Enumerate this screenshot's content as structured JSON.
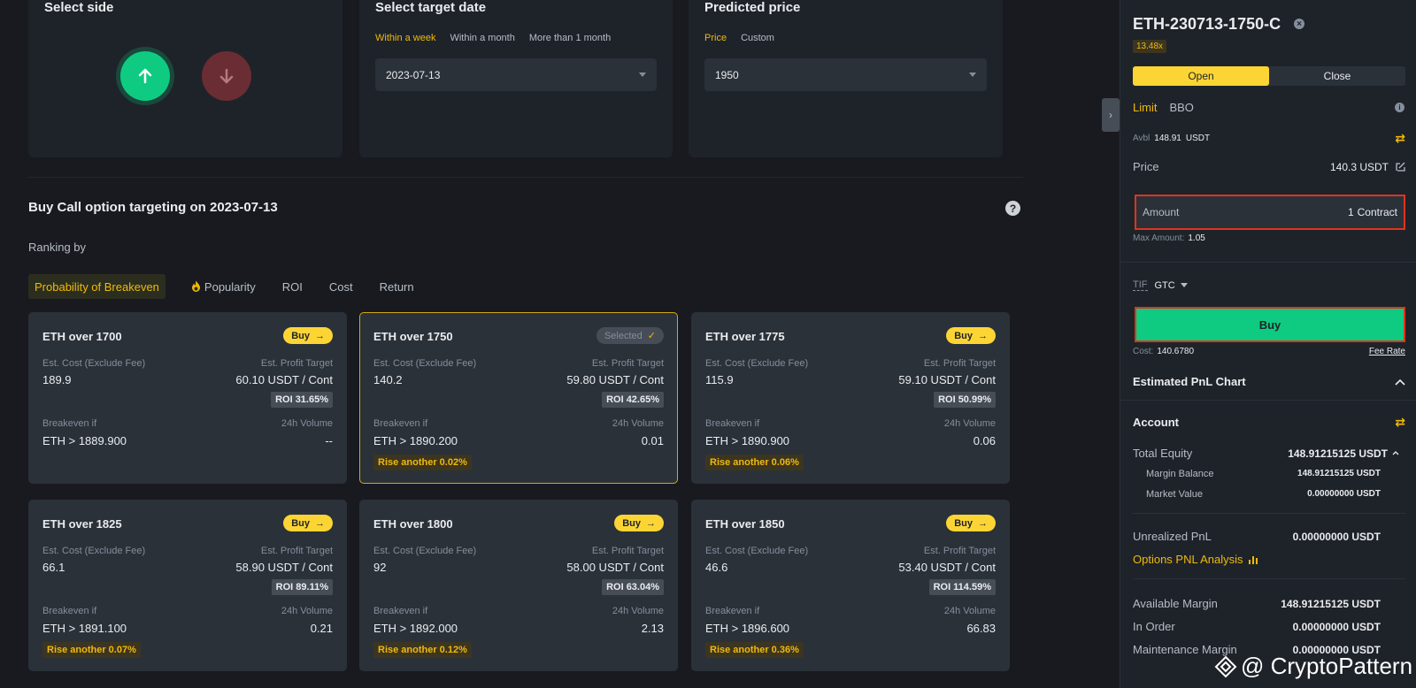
{
  "panels": {
    "side": {
      "title": "Select side"
    },
    "date": {
      "title": "Select target date",
      "tabs": [
        "Within a week",
        "Within a month",
        "More than 1 month"
      ],
      "active_tab": 0,
      "value": "2023-07-13"
    },
    "price": {
      "title": "Predicted price",
      "tabs": [
        "Price",
        "Custom"
      ],
      "active_tab": 0,
      "value": "1950"
    }
  },
  "section_title": "Buy Call option targeting on 2023-07-13",
  "ranking_label": "Ranking by",
  "ranking_tabs": [
    "Probability of Breakeven",
    "Popularity",
    "ROI",
    "Cost",
    "Return"
  ],
  "card_labels": {
    "est_cost": "Est. Cost (Exclude Fee)",
    "est_profit": "Est. Profit Target",
    "breakeven": "Breakeven if",
    "volume": "24h Volume",
    "buy": "Buy",
    "selected": "Selected"
  },
  "cards": [
    {
      "title": "ETH over 1700",
      "cost": "189.9",
      "profit": "60.10 USDT / Cont",
      "roi": "ROI 31.65%",
      "breakeven": "ETH > 1889.900",
      "volume": "--",
      "rise": "",
      "selected": false
    },
    {
      "title": "ETH over 1750",
      "cost": "140.2",
      "profit": "59.80 USDT / Cont",
      "roi": "ROI 42.65%",
      "breakeven": "ETH > 1890.200",
      "volume": "0.01",
      "rise": "Rise another 0.02%",
      "selected": true
    },
    {
      "title": "ETH over 1775",
      "cost": "115.9",
      "profit": "59.10 USDT / Cont",
      "roi": "ROI 50.99%",
      "breakeven": "ETH > 1890.900",
      "volume": "0.06",
      "rise": "Rise another 0.06%",
      "selected": false
    },
    {
      "title": "ETH over 1825",
      "cost": "66.1",
      "profit": "58.90 USDT / Cont",
      "roi": "ROI 89.11%",
      "breakeven": "ETH > 1891.100",
      "volume": "0.21",
      "rise": "Rise another 0.07%",
      "selected": false
    },
    {
      "title": "ETH over 1800",
      "cost": "92",
      "profit": "58.00 USDT / Cont",
      "roi": "ROI 63.04%",
      "breakeven": "ETH > 1892.000",
      "volume": "2.13",
      "rise": "Rise another 0.12%",
      "selected": false
    },
    {
      "title": "ETH over 1850",
      "cost": "46.6",
      "profit": "53.40 USDT / Cont",
      "roi": "ROI 114.59%",
      "breakeven": "ETH > 1896.600",
      "volume": "66.83",
      "rise": "Rise another 0.36%",
      "selected": false
    }
  ],
  "order_panel": {
    "symbol": "ETH-230713-1750-C",
    "leverage": "13.48x",
    "open_label": "Open",
    "close_label": "Close",
    "order_types": [
      "Limit",
      "BBO"
    ],
    "avbl_label": "Avbl",
    "avbl_value": "148.91",
    "avbl_unit": "USDT",
    "price_label": "Price",
    "price_value": "140.3 USDT",
    "amount_label": "Amount",
    "amount_value": "1",
    "amount_unit": "Contract",
    "max_amount_label": "Max Amount:",
    "max_amount_value": "1.05",
    "tif_label": "TIF",
    "tif_value": "GTC",
    "buy_label": "Buy",
    "cost_label": "Cost:",
    "cost_value": "140.6780",
    "fee_rate_label": "Fee Rate",
    "pnl_chart_label": "Estimated PnL Chart",
    "account_label": "Account",
    "total_equity_label": "Total Equity",
    "total_equity_value": "148.91215125 USDT",
    "margin_balance_label": "Margin Balance",
    "margin_balance_value": "148.91215125 USDT",
    "market_value_label": "Market Value",
    "market_value_value": "0.00000000 USDT",
    "unrealized_pnl_label": "Unrealized PnL",
    "unrealized_pnl_value": "0.00000000 USDT",
    "pnl_analysis_label": "Options PNL Analysis",
    "available_margin_label": "Available Margin",
    "available_margin_value": "148.91215125 USDT",
    "in_order_label": "In Order",
    "in_order_value": "0.00000000 USDT",
    "maintenance_margin_label": "Maintenance Margin",
    "maintenance_margin_value": "0.00000000 USDT"
  },
  "watermark": "@ CryptoPattern",
  "colors": {
    "accent": "#f0b90b",
    "buy_green": "#0ecb81",
    "sell_red": "#6b2d34",
    "highlight_red": "#e0331e"
  }
}
